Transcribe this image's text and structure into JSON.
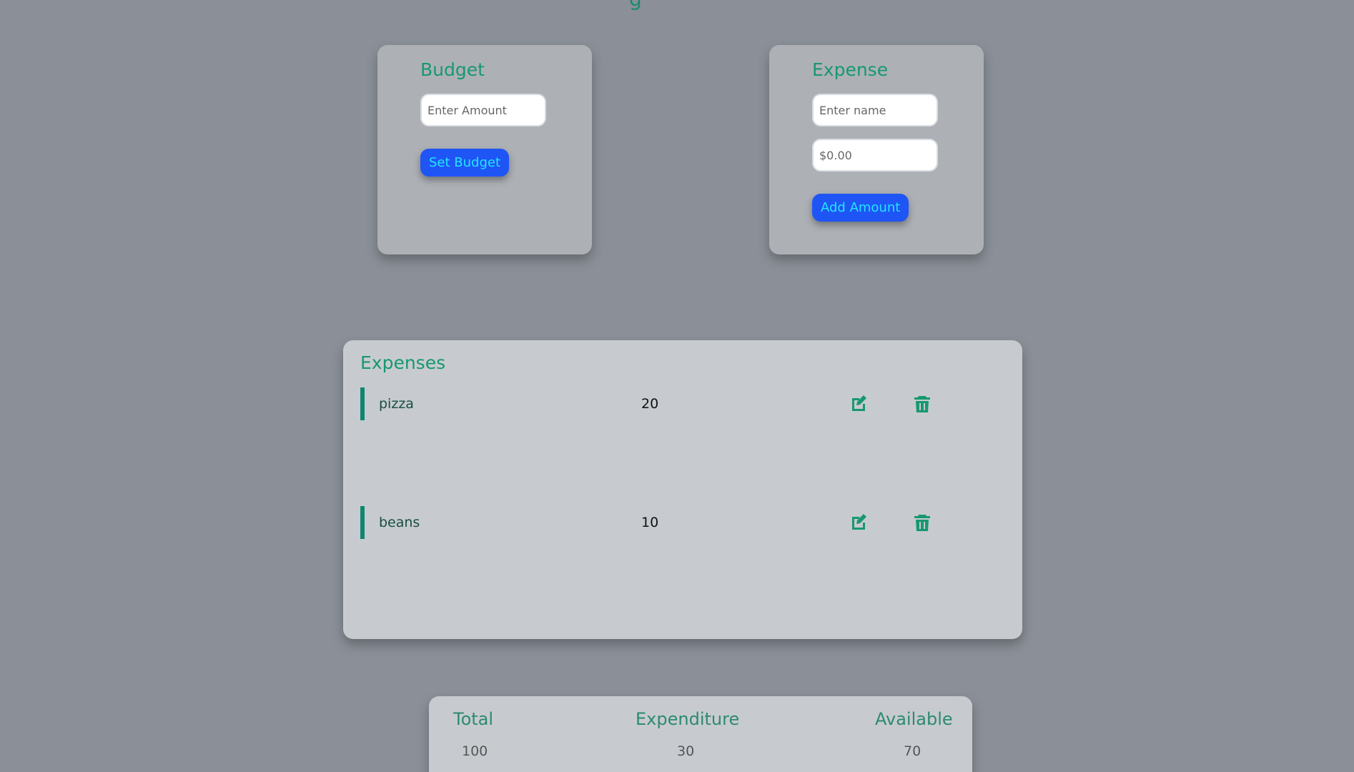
{
  "app": {
    "title_fragment": "g"
  },
  "budget_card": {
    "title": "Budget",
    "amount_placeholder": "Enter Amount",
    "button_label": "Set Budget"
  },
  "expense_card": {
    "title": "Expense",
    "name_placeholder": "Enter name",
    "amount_placeholder": "$0.00",
    "button_label": "Add Amount"
  },
  "expenses": {
    "title": "Expenses",
    "items": [
      {
        "name": "pizza",
        "amount": "20",
        "edit_icon": "edit-icon",
        "delete_icon": "trash-icon"
      },
      {
        "name": "beans",
        "amount": "10",
        "edit_icon": "edit-icon",
        "delete_icon": "trash-icon"
      }
    ]
  },
  "summary": {
    "total_label": "Total",
    "total_value": "100",
    "expenditure_label": "Expenditure",
    "expenditure_value": "30",
    "available_label": "Available",
    "available_value": "70"
  },
  "colors": {
    "page_background": "#8b9098",
    "card_background": "#adb1b6",
    "panel_background": "#c7cbcf",
    "accent_green": "#17986f",
    "button_blue": "#1f55f5",
    "button_text": "#21e6ff"
  }
}
